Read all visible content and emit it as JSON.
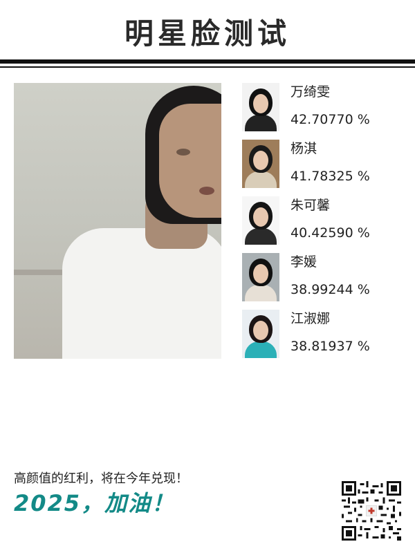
{
  "header": {
    "title": "明星脸测试"
  },
  "photo": {
    "alt": "user-photo"
  },
  "matches": [
    {
      "name": "万绮雯",
      "score": "42.70770 %",
      "colors": {
        "bg": "#f2f2f2",
        "hair": "#111111",
        "body": "#222222"
      }
    },
    {
      "name": "杨淇",
      "score": "41.78325 %",
      "colors": {
        "bg": "#9e7d5a",
        "hair": "#1a1a1a",
        "body": "#d9cdb8"
      }
    },
    {
      "name": "朱可馨",
      "score": "40.42590 %",
      "colors": {
        "bg": "#f6f6f6",
        "hair": "#151515",
        "body": "#2a2a2a"
      }
    },
    {
      "name": "李媛",
      "score": "38.99244 %",
      "colors": {
        "bg": "#a9b0b3",
        "hair": "#111111",
        "body": "#e7e0d6"
      }
    },
    {
      "name": "江淑娜",
      "score": "38.81937 %",
      "colors": {
        "bg": "#e9eef2",
        "hair": "#1c1515",
        "body": "#2bb0b7"
      }
    }
  ],
  "footer": {
    "slogan": "高颜值的红利，将在今年兑现！",
    "cheer": "2025，加油！",
    "accent": "#138a87"
  }
}
